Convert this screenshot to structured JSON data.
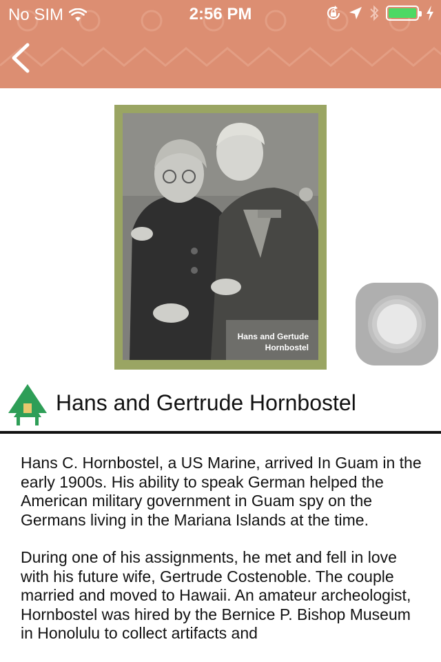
{
  "status_bar": {
    "carrier": "No SIM",
    "time": "2:56 PM"
  },
  "colors": {
    "header": "#dc8e72",
    "frame": "#9aa563",
    "hut_roof": "#2e9e57",
    "hut_door": "#e8c86e",
    "battery": "#4cd964"
  },
  "icons": {
    "back": "chevron-left-icon",
    "wifi": "wifi-icon",
    "lock_rotation": "rotation-lock-icon",
    "location": "location-arrow-icon",
    "bluetooth": "bluetooth-icon",
    "battery": "battery-icon",
    "charging": "charging-bolt-icon",
    "title": "hut-icon",
    "assistive": "assistive-touch-icon"
  },
  "photo": {
    "caption_line1": "Hans and Gertude",
    "caption_line2": "Hornbostel"
  },
  "article": {
    "title": "Hans and Gertrude Hornbostel",
    "paragraphs": [
      "Hans C. Hornbostel, a US Marine, arrived In Guam in the early 1900s. His ability to speak German helped the American military government in Guam spy on the Germans living in the Mariana Islands at the time.",
      "During one of his assignments, he met and fell in love with his future wife, Gertrude Costenoble. The couple married and moved to Hawaii. An amateur archeologist, Hornbostel was hired by the Bernice P. Bishop Museum in Honolulu to collect artifacts and"
    ]
  }
}
